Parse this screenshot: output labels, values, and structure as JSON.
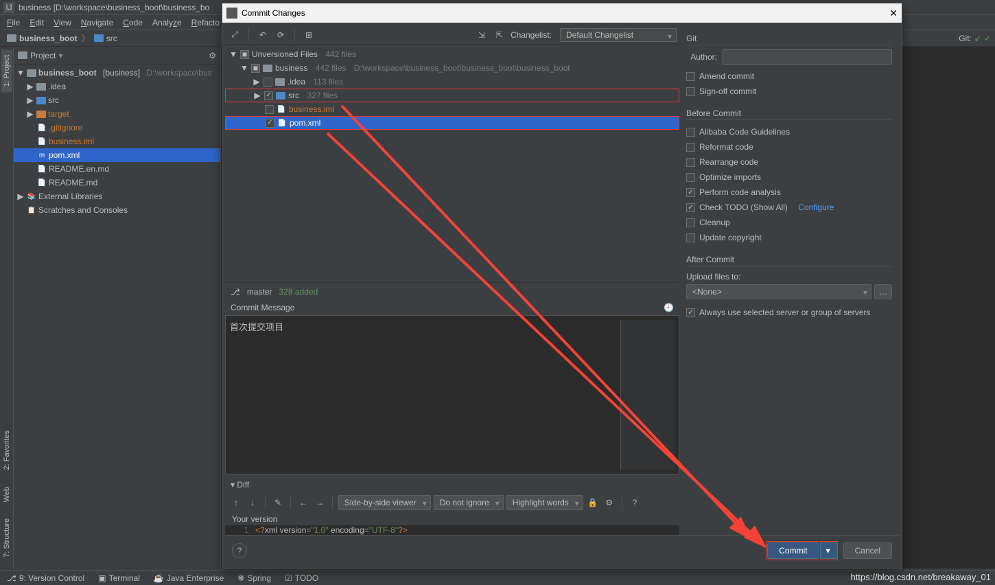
{
  "titlebar": {
    "text": "business [D:\\workspace\\business_boot\\business_bo"
  },
  "menu": [
    "File",
    "Edit",
    "View",
    "Navigate",
    "Code",
    "Analyze",
    "Refactor"
  ],
  "breadcrumb": {
    "root": "business_boot",
    "child": "src"
  },
  "git_label": "Git:",
  "project_header": "Project",
  "tree": {
    "root": "business_boot",
    "root_suffix": "[business]",
    "root_path": "D:\\workspace\\bus",
    "idea": ".idea",
    "src": "src",
    "target": "target",
    "gitignore": ".gitignore",
    "iml": "business.iml",
    "pom": "pom.xml",
    "readme_en": "README.en.md",
    "readme": "README.md",
    "ext": "External Libraries",
    "scratch": "Scratches and Consoles"
  },
  "side": {
    "project": "1: Project",
    "favorites": "2: Favorites",
    "web": "Web",
    "structure": "7: Structure"
  },
  "bottom": {
    "vc": "9: Version Control",
    "term": "Terminal",
    "java": "Java Enterprise",
    "spring": "Spring",
    "todo": "TODO"
  },
  "dialog": {
    "title": "Commit Changes",
    "changelist_label": "Changelist:",
    "changelist_value": "Default Changelist",
    "git": "Git",
    "unversioned": "Unversioned Files",
    "unversioned_count": "442 files",
    "business": "business",
    "business_count": "442 files",
    "business_path": "D:\\workspace\\business_boot\\business_boot\\business_boot",
    "idea": ".idea",
    "idea_count": "113 files",
    "src": "src",
    "src_count": "327 files",
    "iml": "business.iml",
    "pom": "pom.xml",
    "branch": "master",
    "added": "328 added",
    "commit_msg_label": "Commit Message",
    "commit_msg_value": "首次提交项目",
    "diff": "Diff",
    "viewer": "Side-by-side viewer",
    "ignore": "Do not ignore",
    "highlight": "Highlight words",
    "your_version": "Your version",
    "code_line": "<?xml version=\"1.0\" encoding=\"UTF-8\"?>",
    "author_label": "Author:",
    "amend": "Amend commit",
    "signoff": "Sign-off commit",
    "before": "Before Commit",
    "alibaba": "Alibaba Code Guidelines",
    "reformat": "Reformat code",
    "rearrange": "Rearrange code",
    "optimize": "Optimize imports",
    "perform": "Perform code analysis",
    "todo": "Check TODO (Show All)",
    "todo_link": "Configure",
    "cleanup": "Cleanup",
    "copyright": "Update copyright",
    "after": "After Commit",
    "upload_label": "Upload files to:",
    "upload_value": "<None>",
    "always": "Always use selected server or group of servers",
    "commit_btn": "Commit",
    "cancel_btn": "Cancel"
  },
  "watermark": "https://blog.csdn.net/breakaway_01"
}
